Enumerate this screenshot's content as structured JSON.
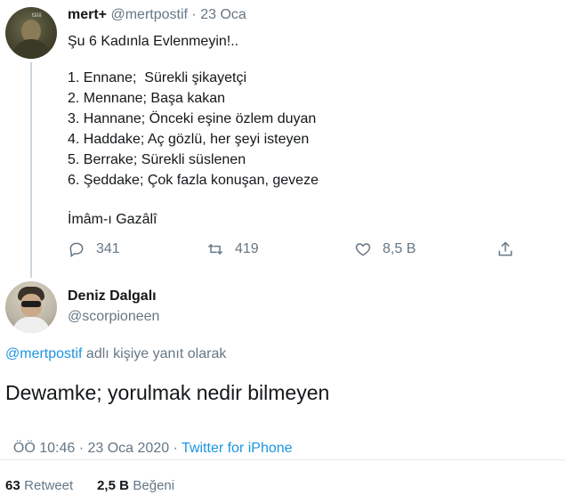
{
  "parent_tweet": {
    "display_name": "mert+",
    "handle": "@mertpostif",
    "separator": "·",
    "date": "23 Oca",
    "title": "Şu 6 Kadınla Evlenmeyin!..",
    "list": [
      "1. Ennane;  Sürekli şikayetçi",
      "2. Mennane; Başa kakan",
      "3. Hannane; Önceki eşine özlem duyan",
      "4. Haddake; Aç gözlü, her şeyi isteyen",
      "5. Berrake; Sürekli süslenen",
      "6. Şeddake; Çok fazla konuşan, geveze"
    ],
    "signature": "İmâm-ı Gazâlî",
    "actions": {
      "reply_count": "341",
      "retweet_count": "419",
      "like_count": "8,5 B"
    }
  },
  "reply_tweet": {
    "display_name": "Deniz Dalgalı",
    "handle": "@scorpioneen",
    "replying_to_handle": "@mertpostif",
    "replying_to_suffix": " adlı kişiye yanıt olarak",
    "text": "Dewamke; yorulmak nedir bilmeyen",
    "meta_time": "ÖÖ 10:46 · 23 Oca 2020 · ",
    "meta_source": "Twitter for iPhone"
  },
  "stats": {
    "retweet_num": "63",
    "retweet_label": "Retweet",
    "like_num": "2,5 B",
    "like_label": "Beğeni"
  },
  "colors": {
    "link": "#1b95e0",
    "muted": "#657786",
    "text": "#14171a",
    "divider": "#e1e8ed"
  }
}
